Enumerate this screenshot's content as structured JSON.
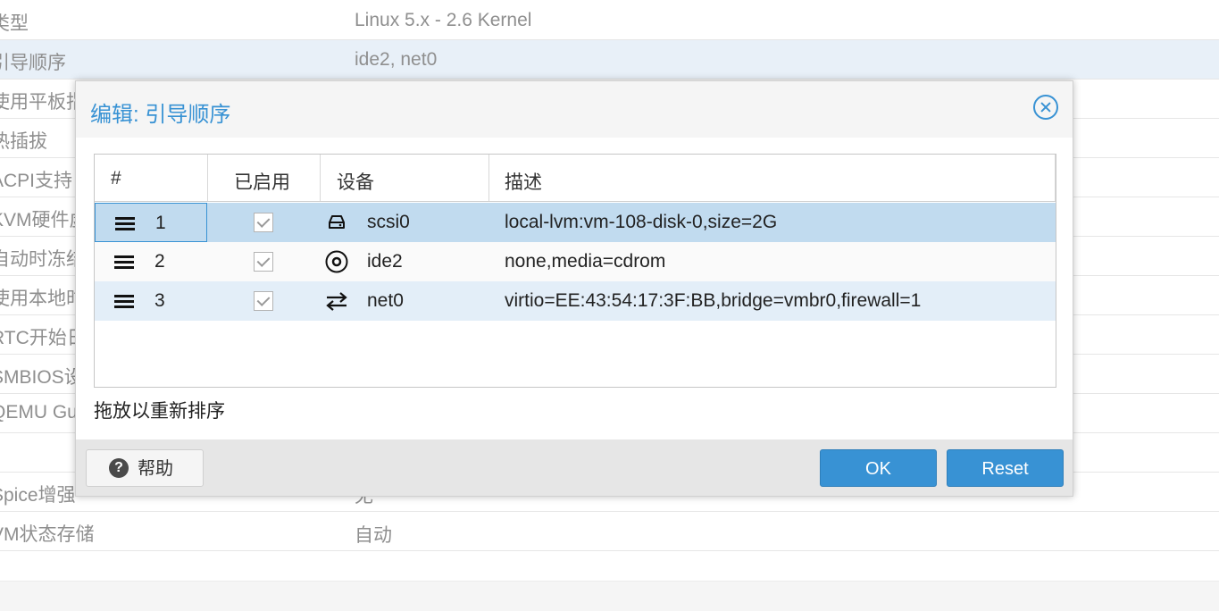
{
  "background": {
    "rows": [
      {
        "key": "类型",
        "value": "Linux 5.x - 2.6 Kernel",
        "selected": false
      },
      {
        "key": "引导顺序",
        "value": "ide2, net0",
        "selected": true
      },
      {
        "key": "使用平板指针",
        "value": "",
        "selected": false
      },
      {
        "key": "热插拔",
        "value": "",
        "selected": false
      },
      {
        "key": "ACPI支持",
        "value": "",
        "selected": false
      },
      {
        "key": "KVM硬件虚拟化",
        "value": "",
        "selected": false
      },
      {
        "key": "自动时冻结CPU",
        "value": "",
        "selected": false
      },
      {
        "key": "使用本地时间",
        "value": "",
        "selected": false
      },
      {
        "key": "RTC开始日期",
        "value": "",
        "selected": false
      },
      {
        "key": "SMBIOS设置",
        "value": "",
        "selected": false
      },
      {
        "key": "QEMU Guest",
        "value": "",
        "selected": false
      },
      {
        "key": "",
        "value": "",
        "selected": false
      },
      {
        "key": "Spice增强",
        "value": "无",
        "selected": false
      },
      {
        "key": "VM状态存储",
        "value": "自动",
        "selected": false
      }
    ]
  },
  "dialog": {
    "title": "编辑: 引导顺序",
    "columns": [
      "#",
      "已启用",
      "设备",
      "描述"
    ],
    "rows": [
      {
        "index": "1",
        "enabled": true,
        "device": "scsi0",
        "icon": "hdd-icon",
        "description": "local-lvm:vm-108-disk-0,size=2G"
      },
      {
        "index": "2",
        "enabled": true,
        "device": "ide2",
        "icon": "cdrom-icon",
        "description": "none,media=cdrom"
      },
      {
        "index": "3",
        "enabled": true,
        "device": "net0",
        "icon": "exchange-icon",
        "description": "virtio=EE:43:54:17:3F:BB,bridge=vmbr0,firewall=1"
      }
    ],
    "hint": "拖放以重新排序",
    "buttons": {
      "help": "帮助",
      "ok": "OK",
      "reset": "Reset"
    }
  },
  "colors": {
    "accent": "#3892d4",
    "selected_row": "#c1dbef",
    "footer_bg": "#e6e6e6"
  }
}
